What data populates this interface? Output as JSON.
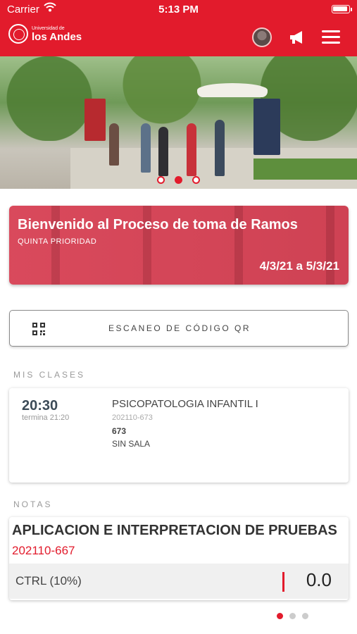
{
  "status_bar": {
    "carrier": "Carrier",
    "time": "5:13 PM"
  },
  "header": {
    "logo_small": "Universidad de",
    "logo_big": "los Andes",
    "icons": [
      "avatar",
      "megaphone-icon",
      "menu-icon"
    ],
    "color": "#e21b2c"
  },
  "hero": {
    "slides": 3,
    "active_slide": 2
  },
  "banner": {
    "title": "Bienvenido al Proceso de toma de Ramos",
    "subtitle": "QUINTA PRIORIDAD",
    "dates": "4/3/21 a 5/3/21"
  },
  "qr_button": {
    "label": "ESCANEO DE CÓDIGO QR",
    "icon": "qr-code-icon"
  },
  "classes": {
    "section_label": "MIS CLASES",
    "items": [
      {
        "time": "20:30",
        "ends": "termina 21:20",
        "course": "PSICOPATOLOGIA INFANTIL I",
        "code": "202110-673",
        "section": "673",
        "room": "SIN SALA"
      }
    ]
  },
  "grades": {
    "section_label": "NOTAS",
    "course": "APLICACION E INTERPRETACION DE PRUEBAS",
    "code": "202110-667",
    "rows": [
      {
        "label": "CTRL (10%)",
        "value": "0.0"
      }
    ],
    "pages": 3,
    "active_page": 1
  }
}
